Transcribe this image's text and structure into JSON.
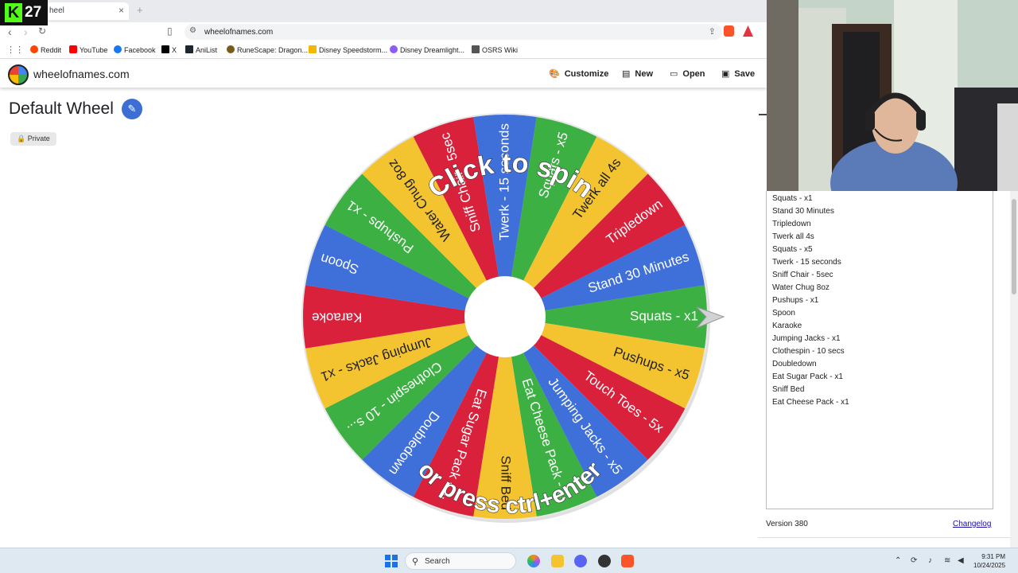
{
  "browser": {
    "tab_title": "heel",
    "url": "wheelofnames.com",
    "stream_counter": "27",
    "bookmarks": [
      "Reddit",
      "YouTube",
      "Facebook",
      "X",
      "AniList",
      "RuneScape: Dragon...",
      "Disney Speedstorm...",
      "Disney Dreamlight...",
      "OSRS Wiki"
    ]
  },
  "site": {
    "name": "wheelofnames.com",
    "customize_label": "Customize",
    "new_label": "New",
    "open_label": "Open",
    "save_label": "Save",
    "wheel_title": "Default Wheel",
    "private_label": "Private"
  },
  "wheel": {
    "top_text": "Click to spin",
    "bottom_text": "or press ctrl+enter",
    "segments": [
      {
        "label": "Squats - x1",
        "color": "#3cb043"
      },
      {
        "label": "Pushups - x5",
        "color": "#f4c430"
      },
      {
        "label": "Touch Toes - 5x",
        "color": "#d9213b"
      },
      {
        "label": "Jumping Jacks - x5",
        "color": "#3f6fd8"
      },
      {
        "label": "Eat Cheese Pack - ...",
        "color": "#3cb043"
      },
      {
        "label": "Sniff Bed",
        "color": "#f4c430"
      },
      {
        "label": "Eat Sugar Pack - ...",
        "color": "#d9213b"
      },
      {
        "label": "Doubledown",
        "color": "#3f6fd8"
      },
      {
        "label": "Clothespin - 10 s...",
        "color": "#3cb043"
      },
      {
        "label": "Jumping Jacks - x1",
        "color": "#f4c430"
      },
      {
        "label": "Karaoke",
        "color": "#d9213b"
      },
      {
        "label": "Spoon",
        "color": "#3f6fd8"
      },
      {
        "label": "Pushups - x1",
        "color": "#3cb043"
      },
      {
        "label": "Water Chug 8oz",
        "color": "#f4c430"
      },
      {
        "label": "Sniff Chair - 5sec",
        "color": "#d9213b"
      },
      {
        "label": "Twerk - 15 seconds",
        "color": "#3f6fd8"
      },
      {
        "label": "Squats - x5",
        "color": "#3cb043"
      },
      {
        "label": "Twerk all 4s",
        "color": "#f4c430"
      },
      {
        "label": "Tripledown",
        "color": "#d9213b"
      },
      {
        "label": "Stand 30 Minutes",
        "color": "#3f6fd8"
      }
    ]
  },
  "entries": [
    "Squats - x1",
    "Stand 30 Minutes",
    "Tripledown",
    "Twerk all 4s",
    "Squats - x5",
    "Twerk - 15 seconds",
    "Sniff Chair - 5sec",
    "Water Chug 8oz",
    "Pushups - x1",
    "Spoon",
    "Karaoke",
    "Jumping Jacks - x1",
    "Clothespin - 10 secs",
    "Doubledown",
    "Eat Sugar Pack - x1",
    "Sniff Bed",
    "Eat Cheese Pack - x1"
  ],
  "footer": {
    "version": "Version 380",
    "changelog": "Changelog"
  },
  "taskbar": {
    "search_label": "Search",
    "time": "9:31 PM",
    "date": "10/24/2025"
  }
}
